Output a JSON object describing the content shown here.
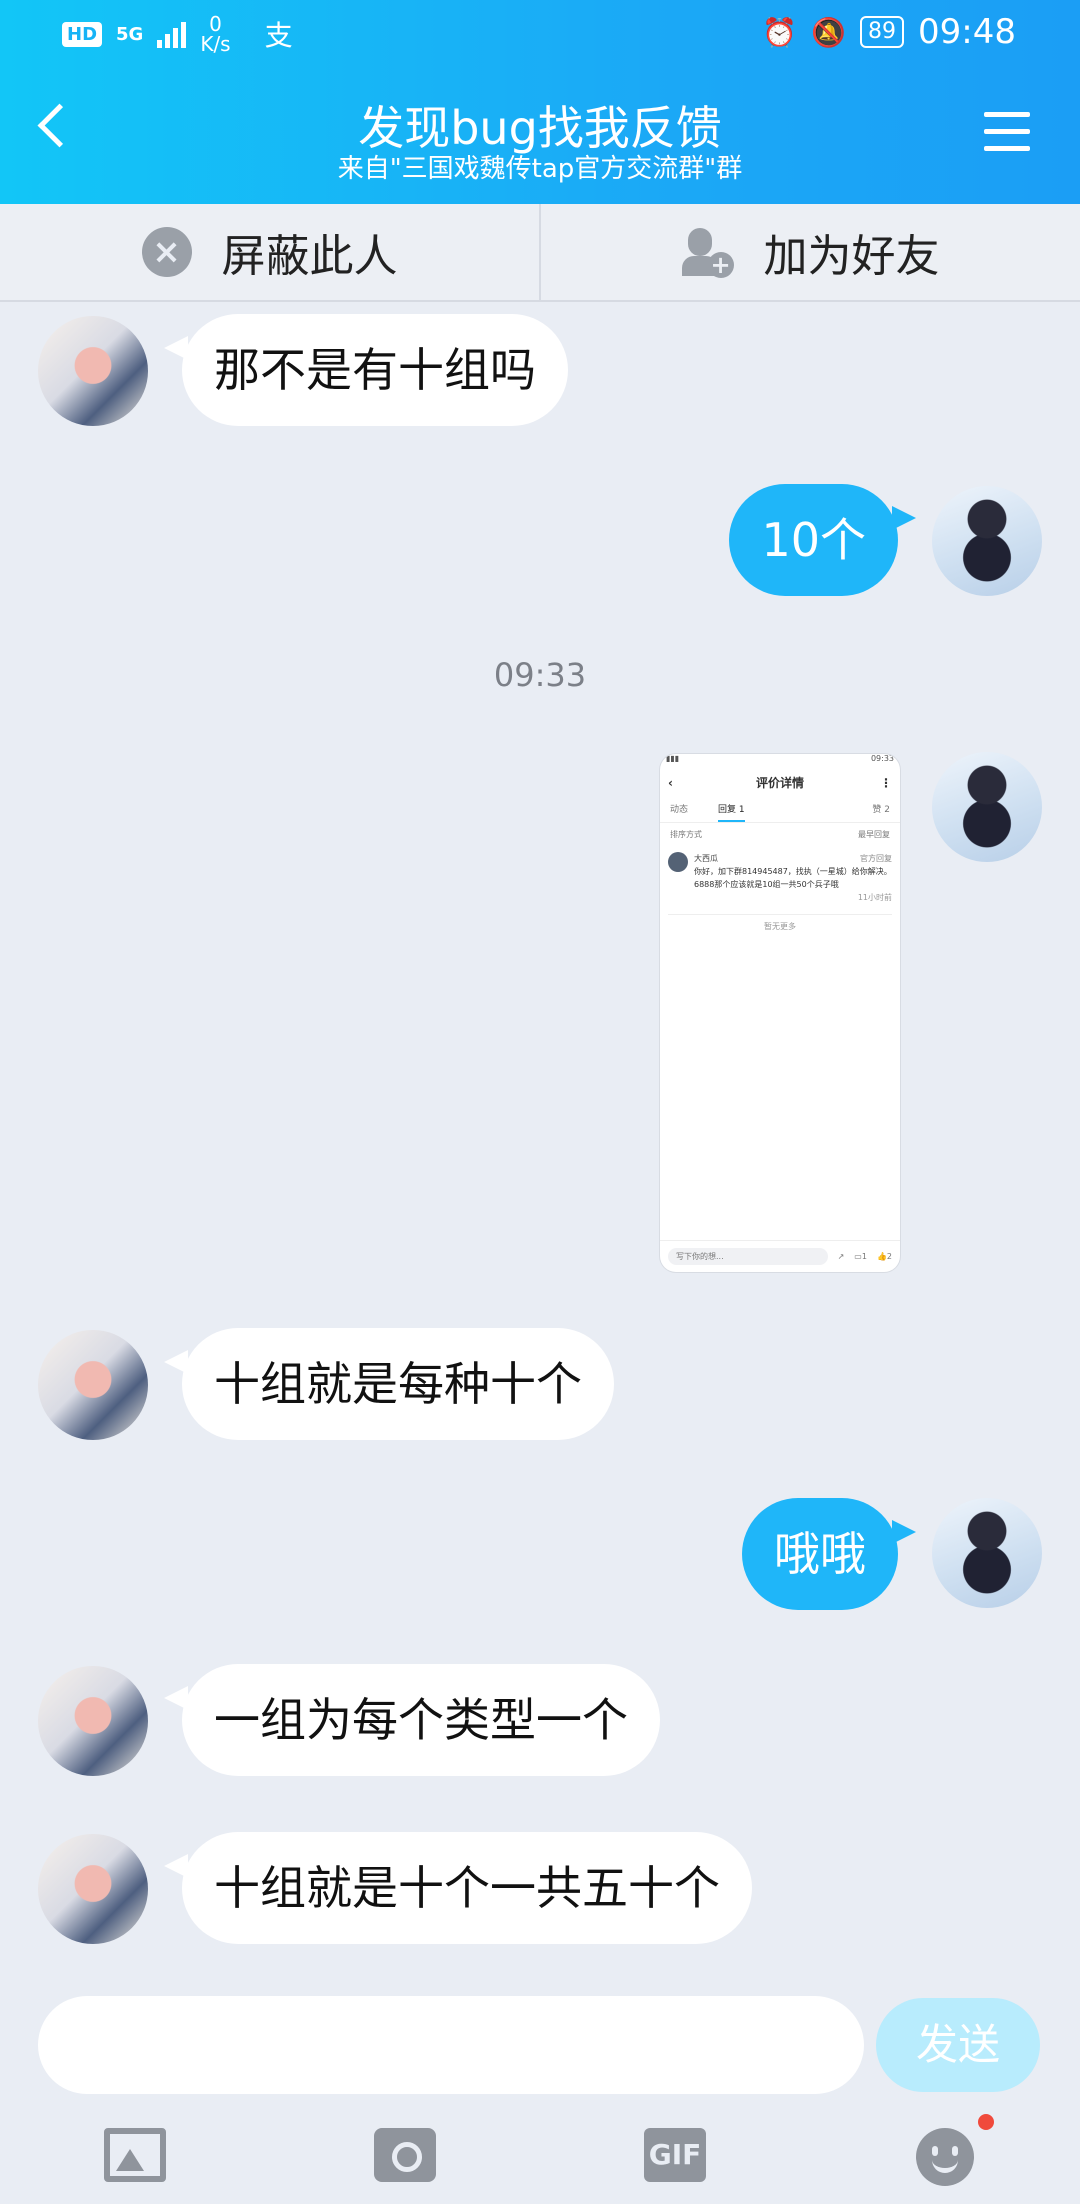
{
  "status": {
    "hd": "HD",
    "network_gen": "5G",
    "speed_value": "0",
    "speed_unit": "K/s",
    "extra_icon": "支",
    "battery": "89",
    "time": "09:48"
  },
  "header": {
    "title": "发现bug找我反馈",
    "subtitle": "来自\"三国戏魏传tap官方交流群\"群"
  },
  "actions": {
    "block_label": "屏蔽此人",
    "add_friend_label": "加为好友"
  },
  "messages": [
    {
      "side": "them",
      "text": "那不是有十组吗"
    },
    {
      "side": "me",
      "text": "10个"
    },
    {
      "side": "me",
      "type": "image"
    },
    {
      "side": "them",
      "text": "十组就是每种十个"
    },
    {
      "side": "me",
      "text": "哦哦"
    },
    {
      "side": "them",
      "text": "一组为每个类型一个"
    },
    {
      "side": "them",
      "text": "十组就是十个一共五十个"
    }
  ],
  "timestamp": "09:33",
  "shared_screenshot": {
    "status_time": "09:33",
    "title": "评价详情",
    "tab1": "动态",
    "tab2": "回复 1",
    "tab3": "赞 2",
    "sort_label": "排序方式",
    "sort_value": "最早回复",
    "commenter": "大西瓜",
    "commenter_tag": "官方回复",
    "comment_text": "你好，加下群814945487，找执（一星城）给你解决。6888那个应该就是10组一共50个兵子哦",
    "comment_time": "11小时前",
    "more": "暂无更多",
    "input_placeholder": "写下你的想...",
    "comments_count": "1",
    "likes_count": "2"
  },
  "composer": {
    "input_value": "",
    "send_label": "发送"
  },
  "toolbar": {
    "gif_label": "GIF",
    "icons": [
      "image-icon",
      "camera-icon",
      "gif-icon",
      "emoji-icon"
    ]
  }
}
